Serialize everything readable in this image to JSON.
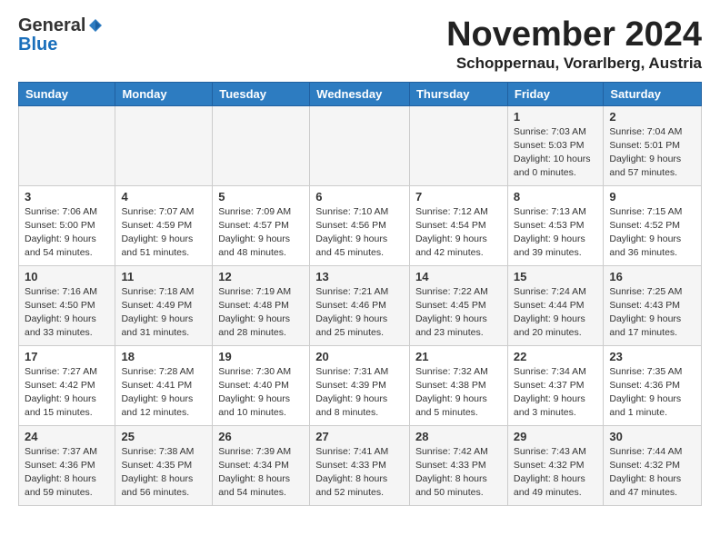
{
  "header": {
    "logo_general": "General",
    "logo_blue": "Blue",
    "month_title": "November 2024",
    "location": "Schoppernau, Vorarlberg, Austria"
  },
  "weekdays": [
    "Sunday",
    "Monday",
    "Tuesday",
    "Wednesday",
    "Thursday",
    "Friday",
    "Saturday"
  ],
  "weeks": [
    [
      {
        "day": "",
        "info": ""
      },
      {
        "day": "",
        "info": ""
      },
      {
        "day": "",
        "info": ""
      },
      {
        "day": "",
        "info": ""
      },
      {
        "day": "",
        "info": ""
      },
      {
        "day": "1",
        "info": "Sunrise: 7:03 AM\nSunset: 5:03 PM\nDaylight: 10 hours\nand 0 minutes."
      },
      {
        "day": "2",
        "info": "Sunrise: 7:04 AM\nSunset: 5:01 PM\nDaylight: 9 hours\nand 57 minutes."
      }
    ],
    [
      {
        "day": "3",
        "info": "Sunrise: 7:06 AM\nSunset: 5:00 PM\nDaylight: 9 hours\nand 54 minutes."
      },
      {
        "day": "4",
        "info": "Sunrise: 7:07 AM\nSunset: 4:59 PM\nDaylight: 9 hours\nand 51 minutes."
      },
      {
        "day": "5",
        "info": "Sunrise: 7:09 AM\nSunset: 4:57 PM\nDaylight: 9 hours\nand 48 minutes."
      },
      {
        "day": "6",
        "info": "Sunrise: 7:10 AM\nSunset: 4:56 PM\nDaylight: 9 hours\nand 45 minutes."
      },
      {
        "day": "7",
        "info": "Sunrise: 7:12 AM\nSunset: 4:54 PM\nDaylight: 9 hours\nand 42 minutes."
      },
      {
        "day": "8",
        "info": "Sunrise: 7:13 AM\nSunset: 4:53 PM\nDaylight: 9 hours\nand 39 minutes."
      },
      {
        "day": "9",
        "info": "Sunrise: 7:15 AM\nSunset: 4:52 PM\nDaylight: 9 hours\nand 36 minutes."
      }
    ],
    [
      {
        "day": "10",
        "info": "Sunrise: 7:16 AM\nSunset: 4:50 PM\nDaylight: 9 hours\nand 33 minutes."
      },
      {
        "day": "11",
        "info": "Sunrise: 7:18 AM\nSunset: 4:49 PM\nDaylight: 9 hours\nand 31 minutes."
      },
      {
        "day": "12",
        "info": "Sunrise: 7:19 AM\nSunset: 4:48 PM\nDaylight: 9 hours\nand 28 minutes."
      },
      {
        "day": "13",
        "info": "Sunrise: 7:21 AM\nSunset: 4:46 PM\nDaylight: 9 hours\nand 25 minutes."
      },
      {
        "day": "14",
        "info": "Sunrise: 7:22 AM\nSunset: 4:45 PM\nDaylight: 9 hours\nand 23 minutes."
      },
      {
        "day": "15",
        "info": "Sunrise: 7:24 AM\nSunset: 4:44 PM\nDaylight: 9 hours\nand 20 minutes."
      },
      {
        "day": "16",
        "info": "Sunrise: 7:25 AM\nSunset: 4:43 PM\nDaylight: 9 hours\nand 17 minutes."
      }
    ],
    [
      {
        "day": "17",
        "info": "Sunrise: 7:27 AM\nSunset: 4:42 PM\nDaylight: 9 hours\nand 15 minutes."
      },
      {
        "day": "18",
        "info": "Sunrise: 7:28 AM\nSunset: 4:41 PM\nDaylight: 9 hours\nand 12 minutes."
      },
      {
        "day": "19",
        "info": "Sunrise: 7:30 AM\nSunset: 4:40 PM\nDaylight: 9 hours\nand 10 minutes."
      },
      {
        "day": "20",
        "info": "Sunrise: 7:31 AM\nSunset: 4:39 PM\nDaylight: 9 hours\nand 8 minutes."
      },
      {
        "day": "21",
        "info": "Sunrise: 7:32 AM\nSunset: 4:38 PM\nDaylight: 9 hours\nand 5 minutes."
      },
      {
        "day": "22",
        "info": "Sunrise: 7:34 AM\nSunset: 4:37 PM\nDaylight: 9 hours\nand 3 minutes."
      },
      {
        "day": "23",
        "info": "Sunrise: 7:35 AM\nSunset: 4:36 PM\nDaylight: 9 hours\nand 1 minute."
      }
    ],
    [
      {
        "day": "24",
        "info": "Sunrise: 7:37 AM\nSunset: 4:36 PM\nDaylight: 8 hours\nand 59 minutes."
      },
      {
        "day": "25",
        "info": "Sunrise: 7:38 AM\nSunset: 4:35 PM\nDaylight: 8 hours\nand 56 minutes."
      },
      {
        "day": "26",
        "info": "Sunrise: 7:39 AM\nSunset: 4:34 PM\nDaylight: 8 hours\nand 54 minutes."
      },
      {
        "day": "27",
        "info": "Sunrise: 7:41 AM\nSunset: 4:33 PM\nDaylight: 8 hours\nand 52 minutes."
      },
      {
        "day": "28",
        "info": "Sunrise: 7:42 AM\nSunset: 4:33 PM\nDaylight: 8 hours\nand 50 minutes."
      },
      {
        "day": "29",
        "info": "Sunrise: 7:43 AM\nSunset: 4:32 PM\nDaylight: 8 hours\nand 49 minutes."
      },
      {
        "day": "30",
        "info": "Sunrise: 7:44 AM\nSunset: 4:32 PM\nDaylight: 8 hours\nand 47 minutes."
      }
    ]
  ]
}
